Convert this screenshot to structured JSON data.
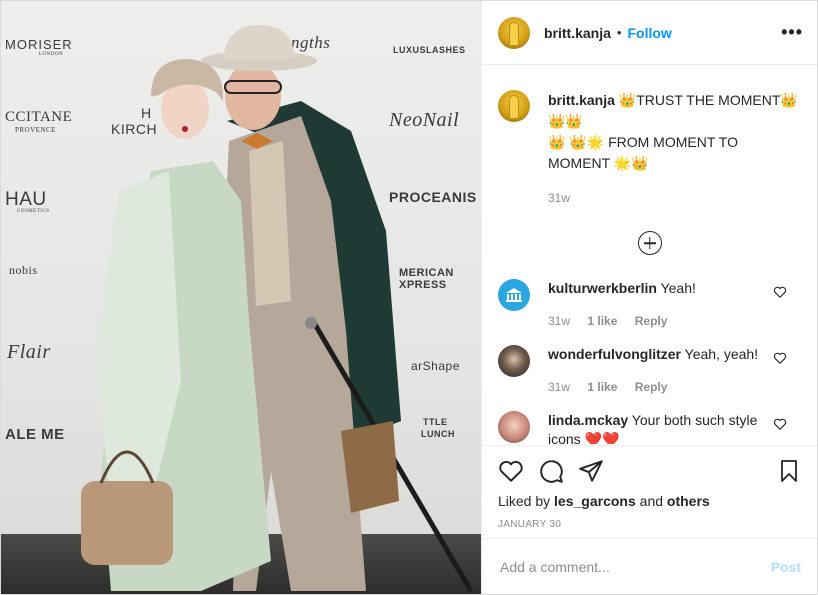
{
  "photo": {
    "wall_logos": [
      "MORISER",
      "LONDON",
      "CCITANE",
      "PROVENCE",
      "HAU",
      "COSMETICS",
      "nobis",
      "Flair",
      "ALE ME",
      "Lengths",
      "LUXUSLASHES",
      "NeoNail",
      "PROCEANIS",
      "MERICAN",
      "XPRESS",
      "arShape",
      "TTLE",
      "LUNCH",
      "H",
      "KIRCH"
    ]
  },
  "header": {
    "username": "britt.kanja",
    "separator": "•",
    "follow_label": "Follow",
    "more_label": "•••"
  },
  "caption": {
    "username": "britt.kanja",
    "text_line1": "👑TRUST THE MOMENT👑👑👑",
    "text_line2": "👑 👑🌟 FROM MOMENT TO MOMENT 🌟👑",
    "time": "31w"
  },
  "comments": [
    {
      "username": "kulturwerkberlin",
      "text": "Yeah!",
      "time": "31w",
      "likes": "1 like",
      "reply": "Reply"
    },
    {
      "username": "wonderfulvonglitzer",
      "text": "Yeah, yeah!",
      "time": "31w",
      "likes": "1 like",
      "reply": "Reply"
    },
    {
      "username": "linda.mckay",
      "text": "Your both such style icons ❤️❤️",
      "time": "",
      "likes": "",
      "reply": ""
    }
  ],
  "likes": {
    "prefix": "Liked by",
    "user": "les_garcons",
    "and": "and",
    "others": "others"
  },
  "date": "JANUARY 30",
  "add_comment": {
    "placeholder": "Add a comment...",
    "post_label": "Post"
  },
  "colors": {
    "link_blue": "#0095f6",
    "post_disabled": "#b2dffc",
    "muted": "#8e8e8e",
    "text": "#262626"
  }
}
